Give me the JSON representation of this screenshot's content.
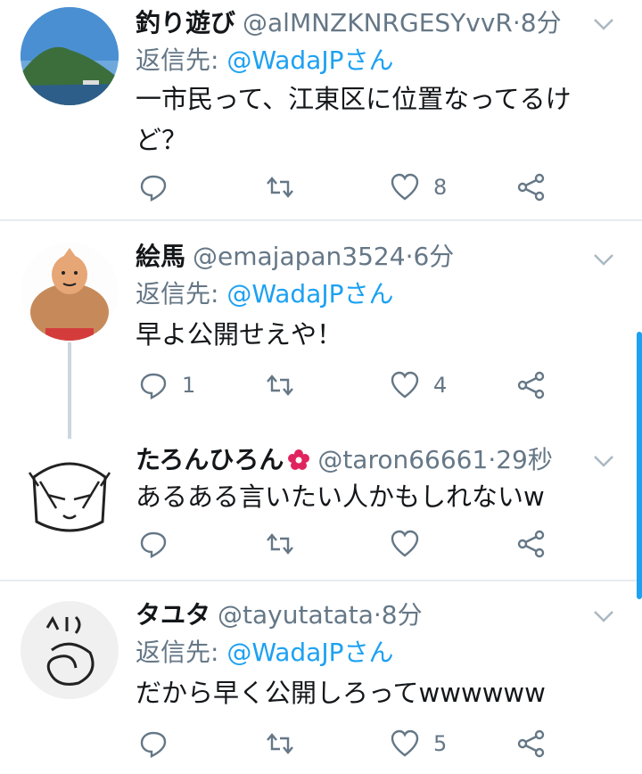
{
  "tweets": [
    {
      "name": "釣り遊び",
      "handle": "@alMNZKNRGESYvvR",
      "time": "8分",
      "reply_to_label": "返信先:",
      "reply_to_mention": "@WadaJPさん",
      "text": "一市民って、江東区に位置なってるけど？",
      "reply_count": "",
      "like_count": "8"
    },
    {
      "name": "絵馬",
      "handle": "@emajapan3524",
      "time": "6分",
      "reply_to_label": "返信先:",
      "reply_to_mention": "@WadaJPさん",
      "text": "早よ公開せえや！",
      "reply_count": "1",
      "like_count": "4"
    },
    {
      "name": "たろんひろん",
      "handle": "@taron66661",
      "time": "29秒",
      "text": "あるある言いたい人かもしれないw",
      "reply_count": "",
      "like_count": ""
    },
    {
      "name": "タユタ",
      "handle": "@tayutatata",
      "time": "8分",
      "reply_to_label": "返信先:",
      "reply_to_mention": "@WadaJPさん",
      "text": "だから早く公開しろってwwwwww",
      "reply_count": "",
      "like_count": "5"
    }
  ],
  "separator": " · ",
  "colors": {
    "accent": "#1da1f2",
    "secondary_text": "#657786",
    "divider": "#e6ecf0",
    "flower": "#e0245e"
  },
  "icons": [
    "reply-icon",
    "retweet-icon",
    "like-icon",
    "share-icon",
    "chevron-down-icon",
    "flower-icon"
  ]
}
